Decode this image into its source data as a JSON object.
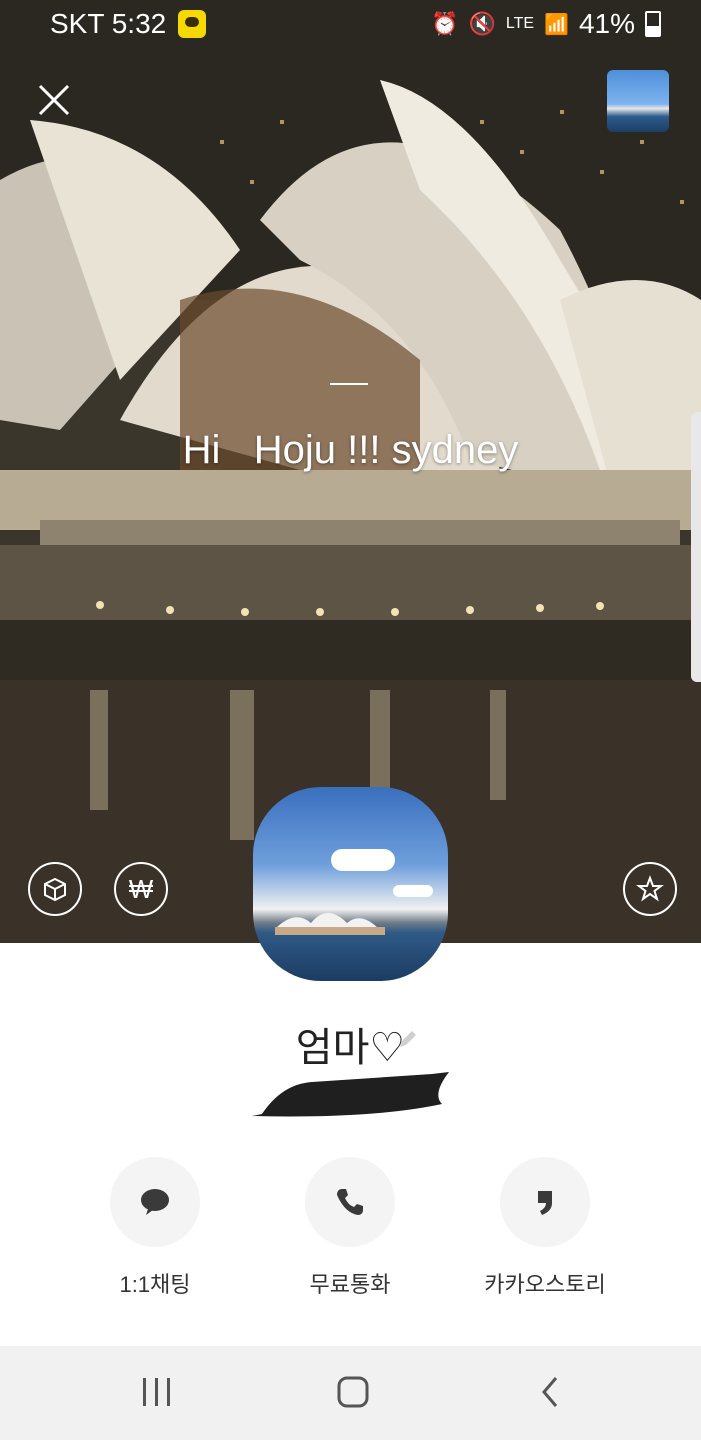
{
  "status_bar": {
    "carrier_time": "SKT 5:32",
    "network": "LTE",
    "battery": "41%"
  },
  "cover": {
    "status_message": "Hi   Hoju !!! sydney"
  },
  "profile": {
    "name": "엄마♡"
  },
  "actions": [
    {
      "label": "1:1채팅",
      "icon": "chat-bubble-icon"
    },
    {
      "label": "무료통화",
      "icon": "phone-icon"
    },
    {
      "label": "카카오스토리",
      "icon": "kakaostory-icon"
    }
  ],
  "colors": {
    "nav_bg": "#f1f1f1",
    "action_bg": "#f4f4f4"
  }
}
